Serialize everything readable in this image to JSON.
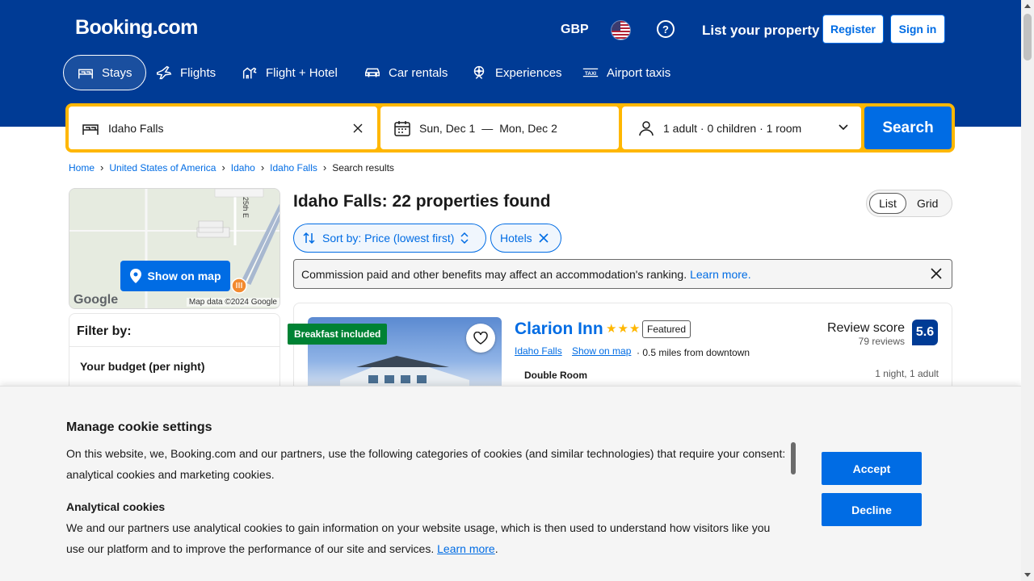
{
  "header": {
    "logo": "Booking.com",
    "currency": "GBP",
    "help_symbol": "?",
    "list_property": "List your property",
    "register": "Register",
    "sign_in": "Sign in"
  },
  "nav": {
    "tabs": [
      {
        "label": "Stays",
        "icon": "bed-icon"
      },
      {
        "label": "Flights",
        "icon": "plane-icon"
      },
      {
        "label": "Flight + Hotel",
        "icon": "flight-hotel-icon"
      },
      {
        "label": "Car rentals",
        "icon": "car-icon"
      },
      {
        "label": "Experiences",
        "icon": "ferris-wheel-icon"
      },
      {
        "label": "Airport taxis",
        "icon": "taxi-icon"
      }
    ]
  },
  "search": {
    "destination": "Idaho Falls",
    "check_in": "Sun, Dec 1",
    "date_sep": "—",
    "check_out": "Mon, Dec 2",
    "guests": "1 adult · 0 children · 1 room",
    "button": "Search"
  },
  "breadcrumb": [
    "Home",
    "United States of America",
    "Idaho",
    "Idaho Falls",
    "Search results"
  ],
  "map": {
    "button": "Show on map",
    "google": "Google",
    "copyright": "Map data ©2024 Google",
    "road_label": "25th E"
  },
  "filter": {
    "title": "Filter by:",
    "budget": "Your budget (per night)"
  },
  "results": {
    "title": "Idaho Falls: 22 properties found",
    "view_list": "List",
    "view_grid": "Grid",
    "sort": "Sort by: Price (lowest first)",
    "chip_hotels": "Hotels",
    "notice": "Commission paid and other benefits may affect an accommodation's ranking.",
    "notice_link": "Learn more."
  },
  "card": {
    "badge": "Breakfast included",
    "name": "Clarion Inn",
    "stars": 3,
    "featured": "Featured",
    "location": "Idaho Falls",
    "show_on_map": "Show on map",
    "distance": "0.5 miles from downtown",
    "room": "Double Room",
    "stay": "1 night, 1 adult",
    "review_label": "Review score",
    "review_count": "79 reviews",
    "score": "5.6"
  },
  "cookie": {
    "title": "Manage cookie settings",
    "text1": "On this website, we, Booking.com and our partners, use the following categories of cookies (and similar technologies) that require your consent: analytical cookies and marketing cookies.",
    "sub": "Analytical cookies",
    "text2": "We and our partners use analytical cookies to gain information on your website usage, which is then used to understand how visitors like you use our platform and to improve the performance of our site and services.",
    "learn_more": "Learn more",
    "period": ".",
    "accept": "Accept",
    "decline": "Decline"
  },
  "colors": {
    "brand_blue": "#003b95",
    "action_blue": "#006ce4",
    "search_yellow": "#ffb700",
    "badge_green": "#008234"
  }
}
